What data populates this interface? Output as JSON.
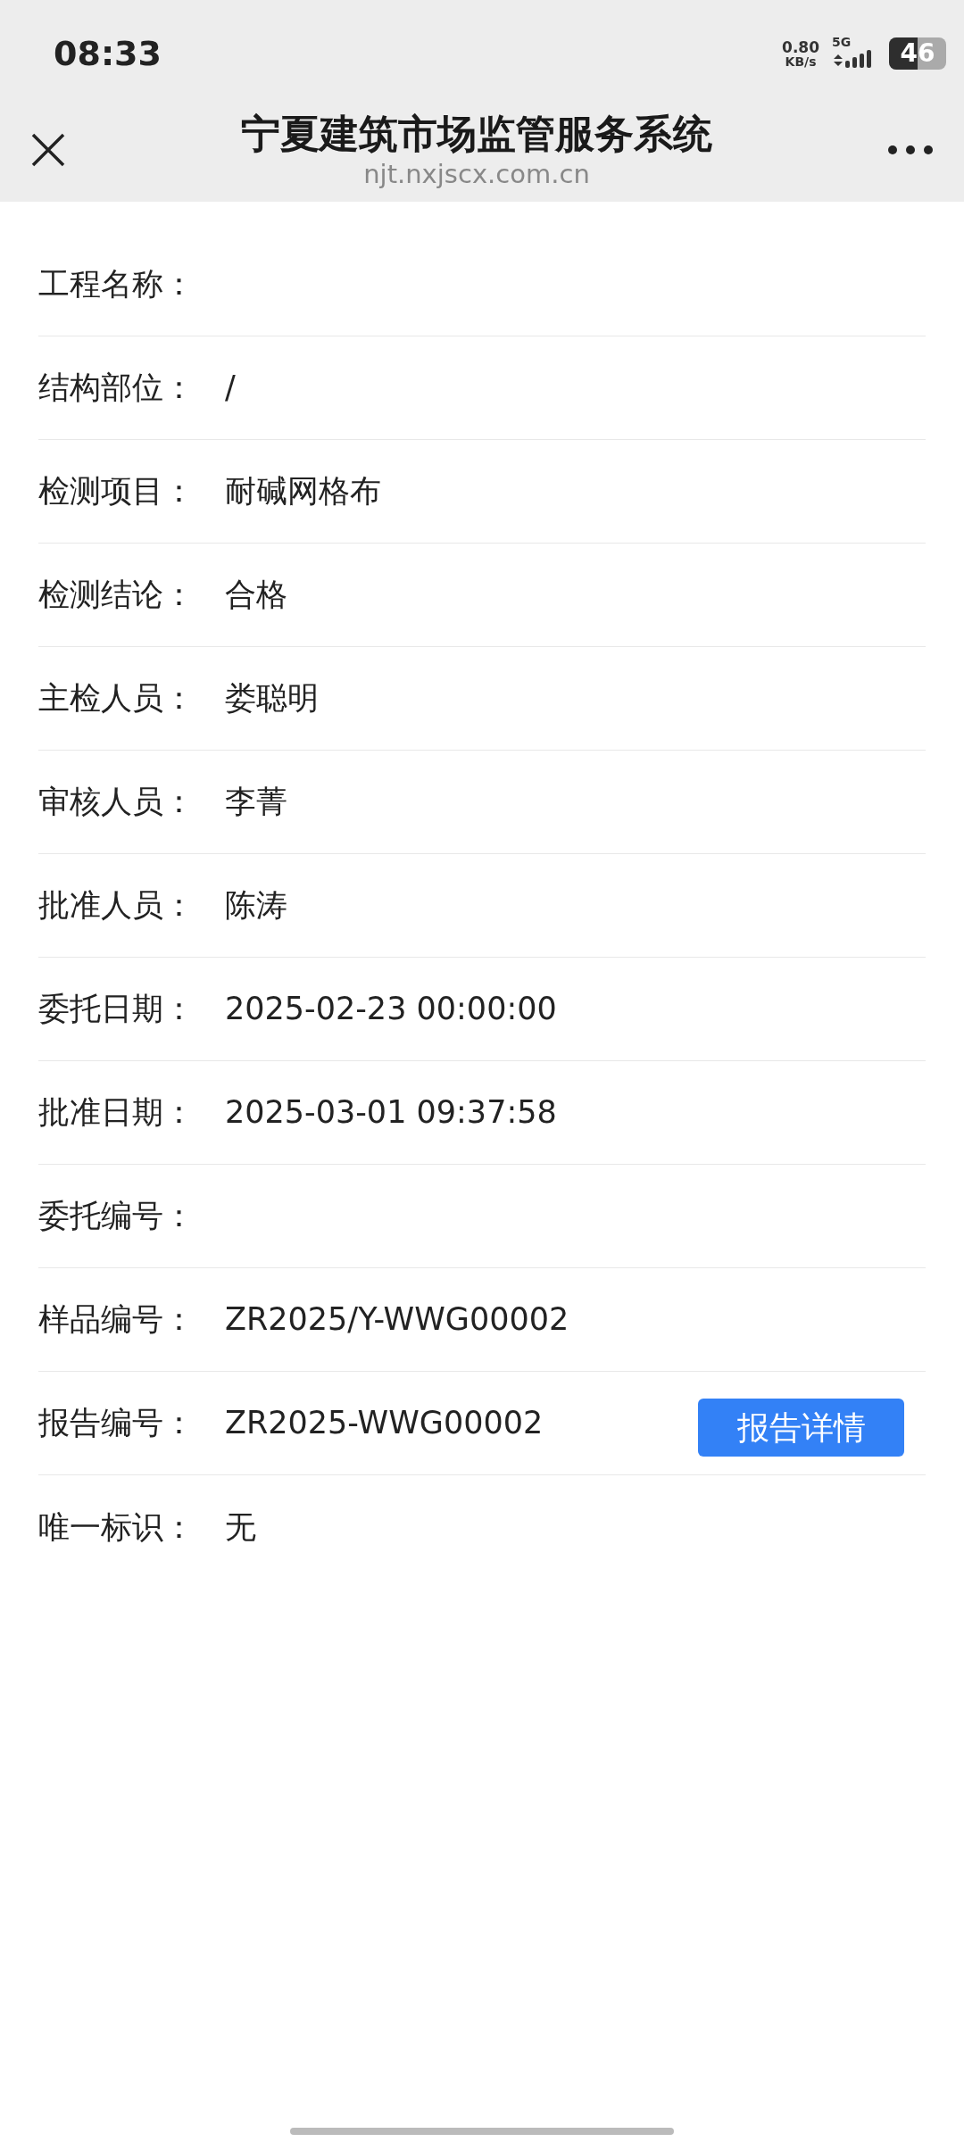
{
  "status_bar": {
    "time": "08:33",
    "speed_value": "0.80",
    "speed_unit": "KB/s",
    "network": "5G",
    "battery": "46"
  },
  "header": {
    "title": "宁夏建筑市场监管服务系统",
    "url": "njt.nxjscx.com.cn"
  },
  "rows": [
    {
      "label": "工程名称："
    },
    {
      "label": "结构部位：",
      "value": "/"
    },
    {
      "label": "检测项目：",
      "value": "耐碱网格布"
    },
    {
      "label": "检测结论：",
      "value": "合格"
    },
    {
      "label": "主检人员：",
      "value": "娄聪明"
    },
    {
      "label": "审核人员：",
      "value": "李菁"
    },
    {
      "label": "批准人员：",
      "value": "陈涛"
    },
    {
      "label": "委托日期：",
      "value": "2025-02-23 00:00:00"
    },
    {
      "label": "批准日期：",
      "value": "2025-03-01 09:37:58"
    },
    {
      "label": "委托编号："
    },
    {
      "label": "样品编号：",
      "value": "ZR2025/Y-WWG00002"
    },
    {
      "label": "报告编号：",
      "value": "ZR2025-WWG00002",
      "button": "报告详情"
    },
    {
      "label": "唯一标识：",
      "value": "无"
    }
  ]
}
